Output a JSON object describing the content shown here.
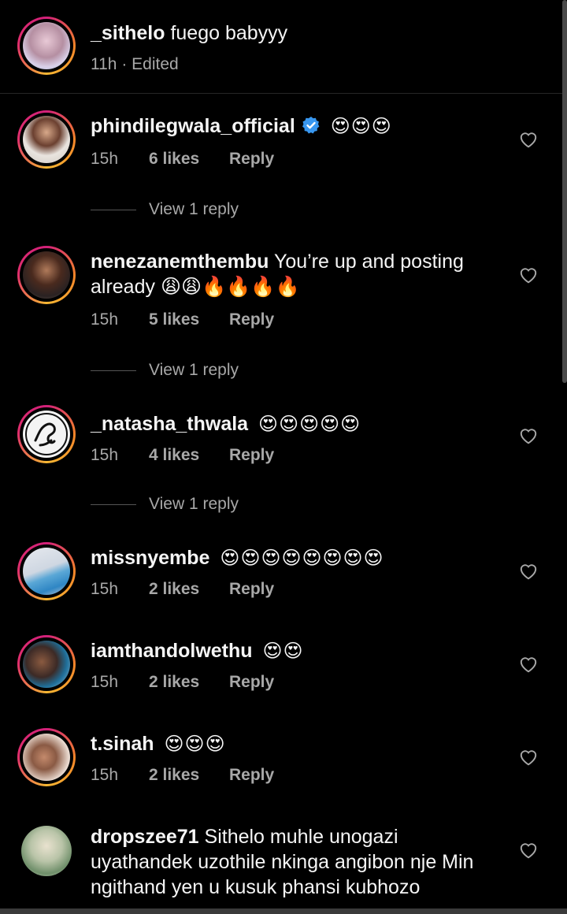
{
  "caption": {
    "username": "_sithelo",
    "text": "fuego babyyy",
    "time": "11h",
    "edited": "· Edited"
  },
  "comments": [
    {
      "username": "phindilegwala_official",
      "verified": true,
      "text": "😍😍😍",
      "time": "15h",
      "likes": "6 likes",
      "reply": "Reply",
      "view_replies": "View 1 reply"
    },
    {
      "username": "nenezanemthembu",
      "text": "You’re up and posting already 😩😩🔥🔥🔥🔥",
      "time": "15h",
      "likes": "5 likes",
      "reply": "Reply",
      "view_replies": "View 1 reply"
    },
    {
      "username": "_natasha_thwala",
      "text": "😍😍😍😍😍",
      "time": "15h",
      "likes": "4 likes",
      "reply": "Reply",
      "view_replies": "View 1 reply"
    },
    {
      "username": "missnyembe",
      "text": "😍😍😍😍😍😍😍😍",
      "time": "15h",
      "likes": "2 likes",
      "reply": "Reply"
    },
    {
      "username": "iamthandolwethu",
      "text": "😍😍",
      "time": "15h",
      "likes": "2 likes",
      "reply": "Reply"
    },
    {
      "username": "t.sinah",
      "text": "😍😍😍",
      "time": "15h",
      "likes": "2 likes",
      "reply": "Reply"
    },
    {
      "username": "dropszee71",
      "text": "Sithelo muhle unogazi uyathandek uzothile nkinga angibon nje Min ngithand yen u kusuk phansi kubhozo"
    }
  ],
  "colors": {
    "background": "#000000",
    "primary_text": "#f5f5f5",
    "secondary_text": "#a8a8a8",
    "verified_blue": "#3897f0",
    "story_ring": "#e1306c"
  },
  "icons": {
    "like": "heart-outline-icon",
    "verified": "verified-badge-icon"
  }
}
